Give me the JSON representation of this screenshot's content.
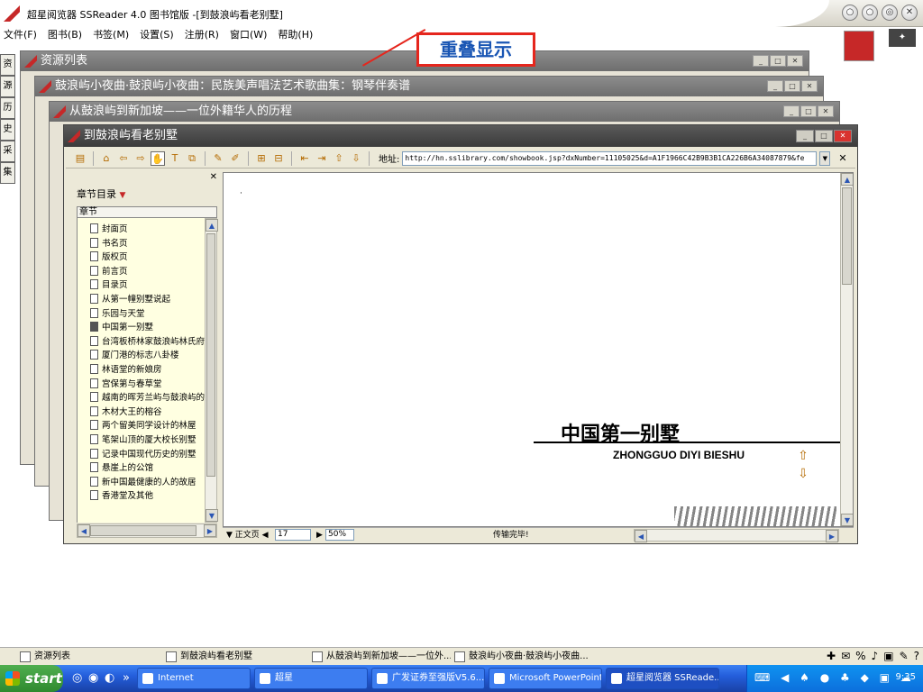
{
  "app": {
    "title": "超星阅览器 SSReader 4.0 图书馆版 -[到鼓浪屿看老别墅]"
  },
  "menu": [
    "文件(F)",
    "图书(B)",
    "书签(M)",
    "设置(S)",
    "注册(R)",
    "窗口(W)",
    "帮助(H)"
  ],
  "side_tabs": [
    "资",
    "源",
    "历",
    "史",
    "采",
    "集"
  ],
  "windows": {
    "w1": "资源列表",
    "w2": "鼓浪屿小夜曲·鼓浪屿小夜曲：民族美声唱法艺术歌曲集：钢琴伴奏谱",
    "w3": "从鼓浪屿到新加坡——一位外籍华人的历程",
    "active": "到鼓浪屿看老别墅"
  },
  "annotation": "重叠显示",
  "toolbar": {
    "address_label": "地址:",
    "address_value": "http://hn.sslibrary.com/showbook.jsp?dxNumber=11105025&d=A1F1966C42B9B3B1CA226B6A34087879&fe"
  },
  "chapters": {
    "dropdown_label": "章节目录",
    "header": "章节",
    "selected_index": 7,
    "items": [
      "封面页",
      "书名页",
      "版权页",
      "前言页",
      "目录页",
      "从第一幢别墅说起",
      "乐园与天堂",
      "中国第一别墅",
      "台湾板桥林家鼓浪屿林氏府",
      "厦门港的标志八卦楼",
      "林语堂的新娘房",
      "宫保第与春草堂",
      "越南的晖芳兰屿与鼓浪屿的",
      "木材大王的榕谷",
      "两个留美同学设计的林屋",
      "笔架山顶的厦大校长别墅",
      "记录中国现代历史的别墅",
      "悬崖上的公馆",
      "新中国最健康的人的故居",
      "香港堂及其他"
    ]
  },
  "page": {
    "title_cn": "中国第一别墅",
    "title_pinyin": "ZHONGGUO DIYI BIESHU"
  },
  "status": {
    "page_mode": "正文页",
    "page_number": "17",
    "zoom": "50%",
    "message": "传输完毕!"
  },
  "mdi_tabs": [
    "资源列表",
    "到鼓浪屿看老别墅",
    "从鼓浪屿到新加坡——一位外...",
    "鼓浪屿小夜曲·鼓浪屿小夜曲..."
  ],
  "taskbar": {
    "start": "start",
    "items": [
      "Internet",
      "超星",
      "广发证券至强版V5.6...",
      "Microsoft PowerPoint -...",
      "超星阅览器 SSReade..."
    ],
    "clock": "9:35"
  }
}
